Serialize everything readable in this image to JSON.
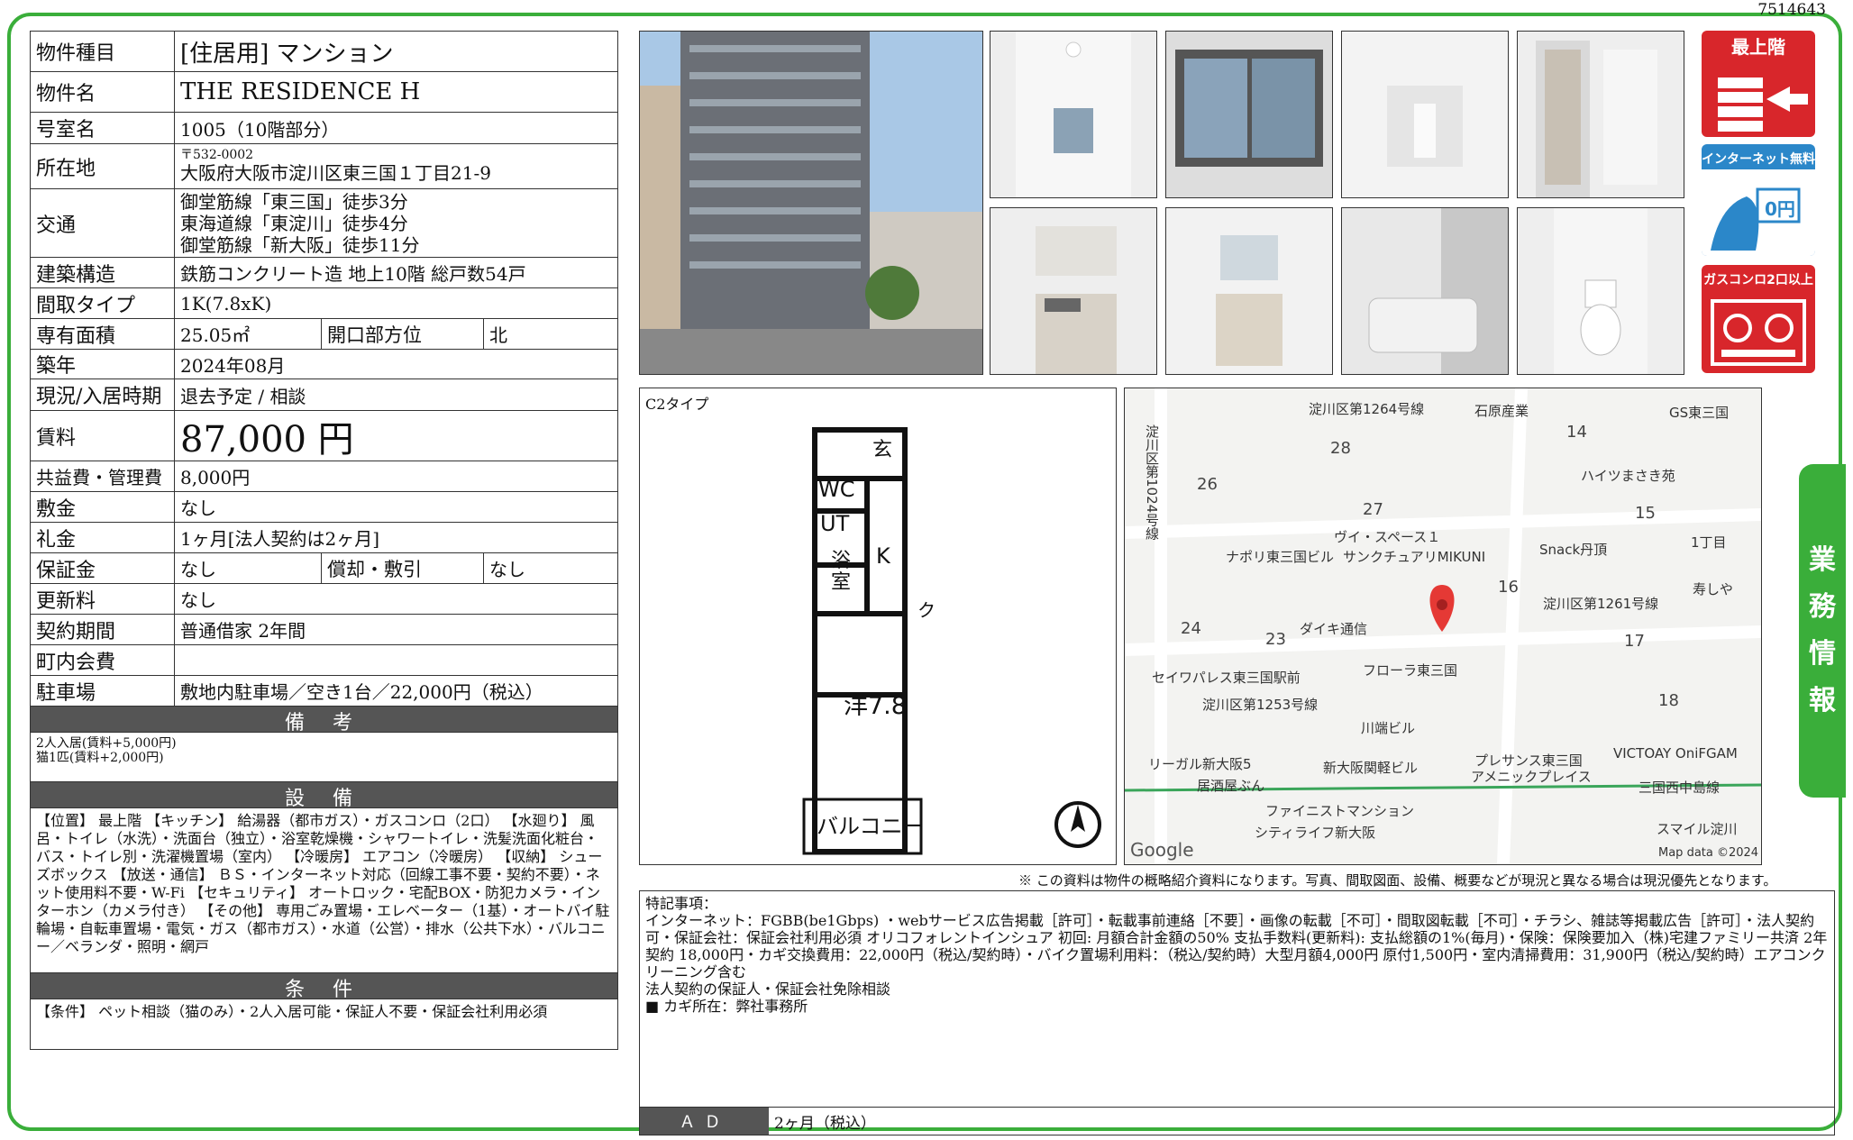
{
  "doc_id": "7514643",
  "property": {
    "type_label": "物件種目",
    "type_value": "[住居用] マンション",
    "name_label": "物件名",
    "name_value": "THE RESIDENCE H",
    "room_label": "号室名",
    "room_value": "1005（10階部分）",
    "addr_label": "所在地",
    "addr_zip": "〒532-0002",
    "addr_value": "大阪府大阪市淀川区東三国１丁目21-9",
    "access_label": "交通",
    "access_1": "御堂筋線「東三国」徒歩3分",
    "access_2": "東海道線「東淀川」徒歩4分",
    "access_3": "御堂筋線「新大阪」徒歩11分",
    "struct_label": "建築構造",
    "struct_value": "鉄筋コンクリート造 地上10階 総戸数54戸",
    "layout_label": "間取タイプ",
    "layout_value": "1K(7.8xK)",
    "area_label": "専有面積",
    "area_value": "25.05㎡",
    "dir_label": "開口部方位",
    "dir_value": "北",
    "built_label": "築年",
    "built_value": "2024年08月",
    "status_label": "現況/入居時期",
    "status_value": "退去予定 / 相談",
    "rent_label": "賃料",
    "rent_value": "87,000 円",
    "mgmt_label": "共益費・管理費",
    "mgmt_value": "8,000円",
    "deposit_label": "敷金",
    "deposit_value": "なし",
    "key_label": "礼金",
    "key_value": "1ヶ月[法人契約は2ヶ月]",
    "guar_label": "保証金",
    "guar_value": "なし",
    "amort_label": "償却・敷引",
    "amort_value": "なし",
    "renew_label": "更新料",
    "renew_value": "なし",
    "term_label": "契約期間",
    "term_value": "普通借家 2年間",
    "assoc_label": "町内会費",
    "assoc_value": "",
    "parking_label": "駐車場",
    "parking_value": "敷地内駐車場／空き1台／22,000円（税込）"
  },
  "remarks": {
    "header": "備 考",
    "line1": "2人入居(賃料+5,000円)",
    "line2": "猫1匹(賃料+2,000円)"
  },
  "equipment": {
    "header": "設 備",
    "text": "【位置】 最上階 【キッチン】 給湯器（都市ガス）・ガスコンロ（2口） 【水廻り】 風呂・トイレ（水洗）・洗面台（独立）・浴室乾燥機・シャワートイレ・洗髪洗面化粧台・バス・トイレ別・洗濯機置場（室内） 【冷暖房】 エアコン（冷暖房） 【収納】 シューズボックス 【放送・通信】 ＢＳ・インターネット対応（回線工事不要・契約不要）・ネット使用料不要・W-Fi 【セキュリティ】 オートロック・宅配BOX・防犯カメラ・インターホン（カメラ付き） 【その他】 専用ごみ置場・エレベーター（1基）・オートバイ駐輪場・自転車置場・電気・ガス（都市ガス）・水道（公営）・排水（公共下水）・バルコニー／ベランダ・照明・網戸"
  },
  "conditions": {
    "header": "条 件",
    "text": "【条件】 ペット相談（猫のみ）・2人入居可能・保証人不要・保証会社利用必須"
  },
  "badges": {
    "top_floor": "最上階",
    "internet": "インターネット無料",
    "internet_price": "0円",
    "gas": "ガスコンロ2口以上"
  },
  "floorplan": {
    "type": "C2タイプ",
    "entrance": "玄",
    "wc": "WC",
    "ut": "UT",
    "bath": "浴室",
    "kitchen": "K",
    "closet": "ク",
    "room": "洋7.8",
    "balcony": "バルコニー"
  },
  "map": {
    "labels": [
      "淀川区第1264号線",
      "石原産業",
      "GS東三国",
      "淀川区第1024号線",
      "ハイツまさき苑",
      "ヴイ・スペース１",
      "ナポリ東三国ビル",
      "サンクチュアリMIKUNI",
      "Snack丹頂",
      "1丁目",
      "寿しや",
      "淀川区第1261号線",
      "ダイキ通信",
      "フローラ東三国",
      "セイワパレス東三国駅前",
      "淀川区第1253号線",
      "川端ビル",
      "リーガル新大阪5",
      "居酒屋ぶん",
      "新大阪関軽ビル",
      "プレサンス東三国",
      "アメニックプレイス",
      "VICTOAY OniFGAM",
      "三国西中島線",
      "ファイニストマンション",
      "シティライフ新大阪",
      "スマイル淀川",
      "Map data ©2024",
      "Google"
    ],
    "numbers": [
      "28",
      "14",
      "26",
      "27",
      "15",
      "16",
      "24",
      "23",
      "17",
      "18"
    ]
  },
  "side_tab": [
    "業",
    "務",
    "情",
    "報"
  ],
  "disclaimer": "※ この資料は物件の概略紹介資料になります。写真、間取図面、設備、概要などが現況と異なる場合は現況優先となります。",
  "special": {
    "title": "特記事項：",
    "line1": "インターネット：FGBB(be1Gbps) ・webサービス広告掲載［許可］・転載事前連絡［不要］・画像の転載［不可］・間取図転載［不可］・チラシ、雑誌等掲載広告［許可］・法人契約可・保証会社：保証会社利用必須 オリコフォレントインシュア 初回: 月額合計金額の50% 支払手数料(更新料): 支払総額の1%(毎月)・保険：保険要加入（株)宅建ファミリー共済 2年契約 18,000円・カギ交換費用：22,000円（税込/契約時）・バイク置場利用料：（税込/契約時）大型月額4,000円 原付1,500円・室内清掃費用：31,900円（税込/契約時）エアコンクリーニング含む",
    "line2": "法人契約の保証人・保証会社免除相談",
    "line3": "■ カギ所在：弊社事務所"
  },
  "ad": {
    "label": "ＡＤ",
    "value": "2ヶ月（税込）"
  }
}
